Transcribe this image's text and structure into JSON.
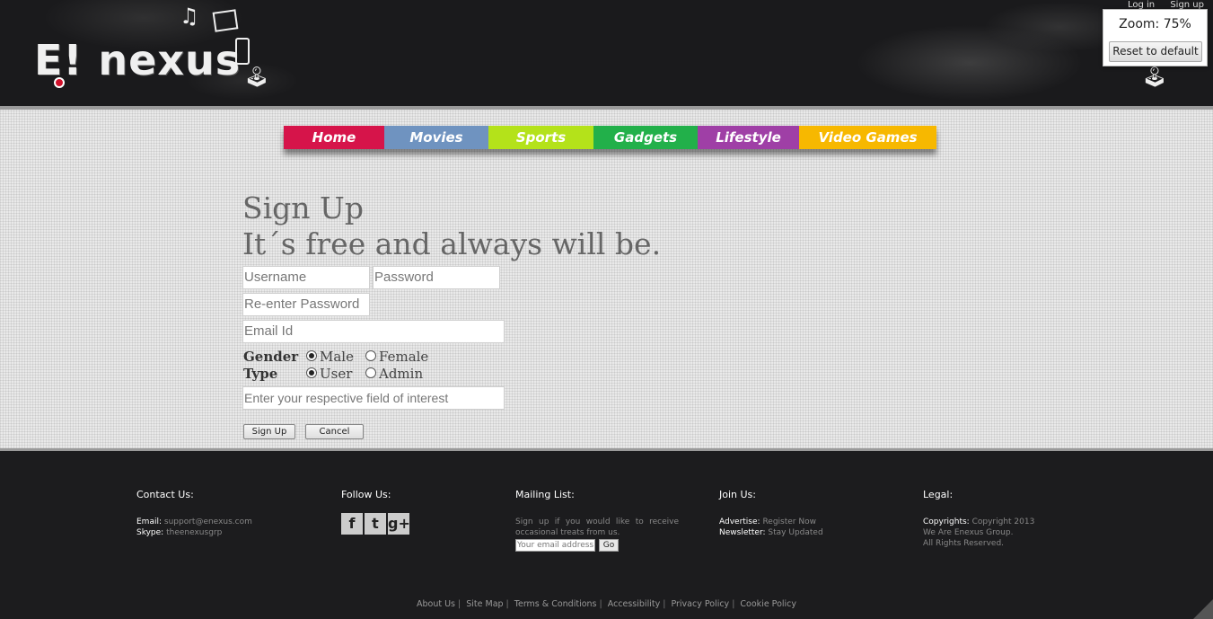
{
  "header": {
    "logo_text": "E! nexus",
    "top_links": [
      "Log in",
      "Sign up"
    ]
  },
  "zoom_popup": {
    "label": "Zoom: 75%",
    "reset_label": "Reset to default"
  },
  "nav": {
    "items": [
      {
        "label": "Home",
        "color": "#d6144a"
      },
      {
        "label": "Movies",
        "color": "#6f93c0"
      },
      {
        "label": "Sports",
        "color": "#b4e21a"
      },
      {
        "label": "Gadgets",
        "color": "#22b04a"
      },
      {
        "label": "Lifestyle",
        "color": "#9f3fa6"
      },
      {
        "label": "Video Games",
        "color": "#f7b800"
      }
    ]
  },
  "form": {
    "title": "Sign Up",
    "subtitle": "It´s free and always will be.",
    "username_placeholder": "Username",
    "password_placeholder": "Password",
    "reenter_placeholder": "Re-enter Password",
    "email_placeholder": "Email Id",
    "interest_placeholder": "Enter your respective field of interest",
    "gender_label": "Gender",
    "gender_options": [
      "Male",
      "Female"
    ],
    "gender_selected": "Male",
    "type_label": "Type",
    "type_options": [
      "User",
      "Admin"
    ],
    "type_selected": "User",
    "signup_button": "Sign Up",
    "cancel_button": "Cancel"
  },
  "footer": {
    "contact": {
      "heading": "Contact Us:",
      "email_label": "Email:",
      "email_value": "support@enexus.com",
      "skype_label": "Skype:",
      "skype_value": "theenexusgrp"
    },
    "follow": {
      "heading": "Follow Us:",
      "icons": [
        "facebook-icon",
        "twitter-icon",
        "google-plus-icon"
      ]
    },
    "mailing": {
      "heading": "Mailing List:",
      "text": "Sign up if you would like to receive occasional treats from us.",
      "input_placeholder": "Your email address",
      "go_label": "Go"
    },
    "join": {
      "heading": "Join Us:",
      "advertise_label": "Advertise:",
      "advertise_value": "Register Now",
      "newsletter_label": "Newsletter:",
      "newsletter_value": "Stay Updated"
    },
    "legal": {
      "heading": "Legal:",
      "copyright_label": "Copyrights:",
      "copyright_value": "Copyright 2013",
      "line2": "We Are Enexus Group.",
      "line3": "All Rights Reserved."
    },
    "bottom_links": [
      "About Us",
      "Site Map",
      "Terms & Conditions",
      "Accessibility",
      "Privacy Policy",
      "Cookie Policy"
    ]
  }
}
